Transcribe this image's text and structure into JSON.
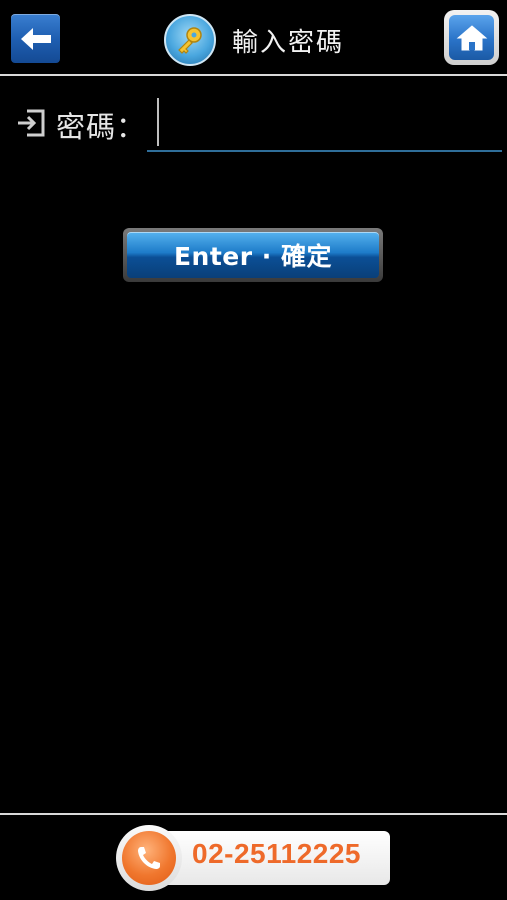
{
  "header": {
    "title": "輸入密碼",
    "back_icon": "arrow-left-icon",
    "title_icon": "key-icon",
    "home_icon": "home-icon"
  },
  "form": {
    "password_label": "密碼：",
    "password_value": "",
    "password_placeholder": "",
    "login_icon": "sign-in-icon"
  },
  "actions": {
    "enter_label": "Enter · 確定"
  },
  "footer": {
    "phone_number": "02-25112225",
    "phone_icon": "phone-icon"
  },
  "colors": {
    "background": "#000000",
    "accent_blue": "#1d7bc9",
    "phone_orange": "#ee6a2a"
  }
}
